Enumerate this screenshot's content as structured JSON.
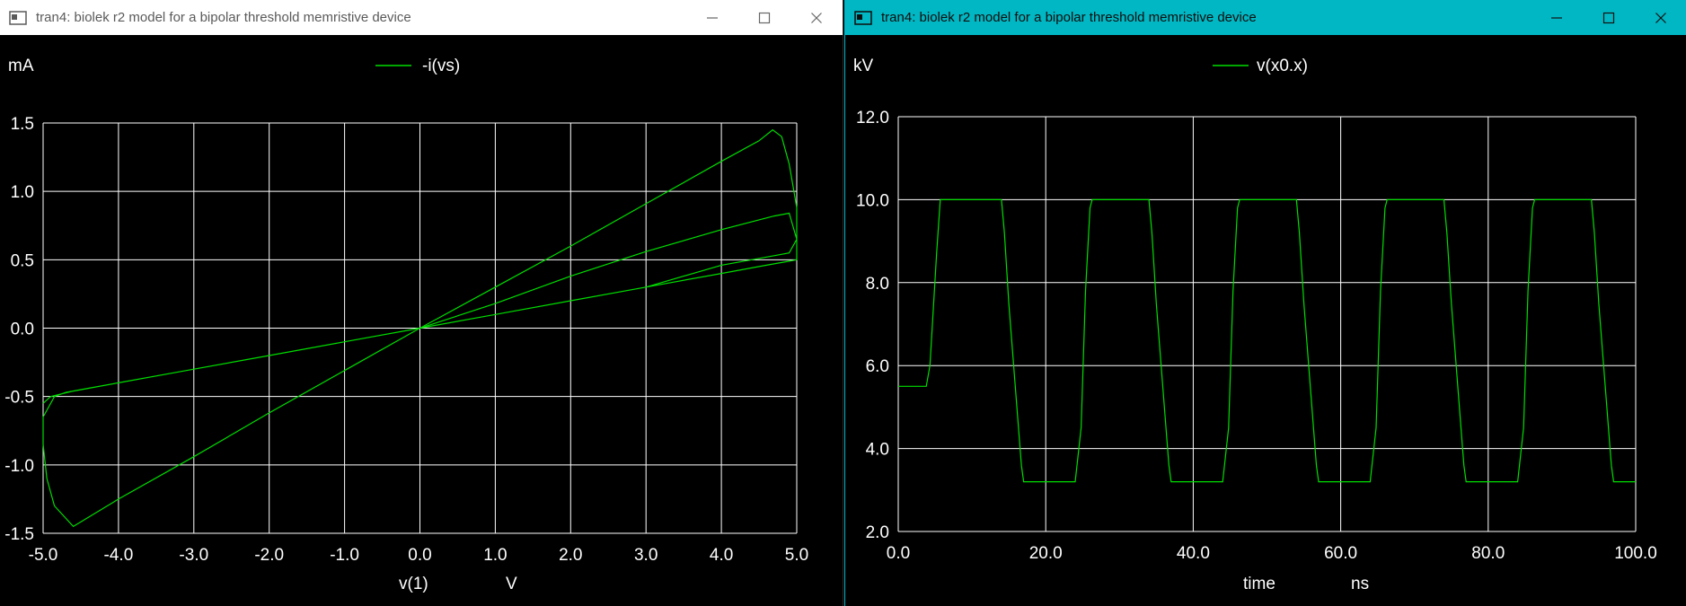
{
  "windows": {
    "left": {
      "title": "tran4: biolek r2 model for a bipolar threshold memristive device",
      "chart": {
        "type": "line",
        "unit_y": "mA",
        "unit_x": "V",
        "xlabel": "v(1)",
        "legend": "-i(vs)",
        "x_ticks": [
          "-5.0",
          "-4.0",
          "-3.0",
          "-2.0",
          "-1.0",
          "0.0",
          "1.0",
          "2.0",
          "3.0",
          "4.0",
          "5.0"
        ],
        "y_ticks": [
          "1.5",
          "1.0",
          "0.5",
          "0.0",
          "-0.5",
          "-1.0",
          "-1.5"
        ]
      }
    },
    "right": {
      "title": "tran4: biolek r2 model for a bipolar threshold memristive device",
      "chart": {
        "type": "line",
        "unit_y": "kV",
        "unit_x": "ns",
        "xlabel": "time",
        "legend": "v(x0.x)",
        "x_ticks": [
          "0.0",
          "20.0",
          "40.0",
          "60.0",
          "80.0",
          "100.0"
        ],
        "y_ticks": [
          "12.0",
          "10.0",
          "8.0",
          "6.0",
          "4.0",
          "2.0"
        ]
      }
    }
  },
  "colors": {
    "trace": "#00dd00",
    "grid": "#ffffff",
    "background": "#000000",
    "title_active": "#00b7c3"
  },
  "chart_data": [
    {
      "type": "line",
      "xlim": [
        -5,
        5
      ],
      "ylim": [
        -1.5,
        1.5
      ],
      "series": [
        {
          "name": "-i(vs)",
          "x": [
            0,
            1,
            2,
            3,
            4,
            4.5,
            4.68,
            4.8,
            4.9,
            5.0,
            5.0,
            4.9,
            4.8,
            4.7,
            4.5,
            4.0,
            3.0,
            2.0,
            1.0,
            0,
            -1.0,
            -2.0,
            -3.0,
            -4.0,
            -4.5,
            -4.7,
            -4.85,
            -5.0,
            -5.0,
            -4.95,
            -4.85,
            -4.6,
            -4.0,
            -3.0,
            -2.0,
            -1.0,
            0,
            1.0,
            2.0,
            3.0,
            4.0,
            4.7,
            4.9,
            5.0,
            4.9,
            4.7,
            4.0,
            3.0,
            2.0,
            1.0,
            0,
            -1.0,
            -2.0,
            -3.0,
            -4.0,
            -4.6,
            -4.9,
            -5.0
          ],
          "y": [
            0,
            0.3,
            0.6,
            0.91,
            1.22,
            1.37,
            1.45,
            1.4,
            1.2,
            0.88,
            0.5,
            0.49,
            0.48,
            0.47,
            0.45,
            0.4,
            0.3,
            0.2,
            0.1,
            0,
            -0.1,
            -0.2,
            -0.3,
            -0.4,
            -0.45,
            -0.47,
            -0.5,
            -0.65,
            -0.85,
            -1.1,
            -1.3,
            -1.45,
            -1.25,
            -0.94,
            -0.62,
            -0.31,
            0,
            0.18,
            0.38,
            0.56,
            0.72,
            0.82,
            0.84,
            0.65,
            0.55,
            0.53,
            0.46,
            0.3,
            0.2,
            0.1,
            0,
            -0.1,
            -0.2,
            -0.3,
            -0.4,
            -0.46,
            -0.5,
            -0.55
          ]
        }
      ]
    },
    {
      "type": "line",
      "xlim": [
        0,
        100
      ],
      "ylim": [
        2,
        12
      ],
      "series": [
        {
          "name": "v(x0.x)",
          "x": [
            0,
            3.8,
            4.3,
            5.2,
            5.7,
            14,
            14.4,
            15,
            16.7,
            17,
            24,
            24.8,
            25.4,
            26,
            26.3,
            34,
            34.4,
            35,
            36.7,
            37,
            44,
            44.8,
            45.4,
            46,
            46.3,
            54,
            54.4,
            55,
            56.7,
            57,
            64,
            64.8,
            65.4,
            66,
            66.3,
            74,
            74.4,
            75,
            76.7,
            77,
            84,
            84.8,
            85.4,
            86,
            86.3,
            94,
            94.4,
            95,
            96.7,
            97,
            100
          ],
          "y": [
            5.5,
            5.5,
            6.0,
            8.7,
            10,
            10,
            9.2,
            7.5,
            3.6,
            3.2,
            3.2,
            4.5,
            7.8,
            9.8,
            10,
            10,
            9.2,
            7.5,
            3.6,
            3.2,
            3.2,
            4.5,
            7.8,
            9.8,
            10,
            10,
            9.2,
            7.5,
            3.6,
            3.2,
            3.2,
            4.5,
            7.8,
            9.8,
            10,
            10,
            9.2,
            7.5,
            3.6,
            3.2,
            3.2,
            4.5,
            7.8,
            9.8,
            10,
            10,
            9.2,
            7.5,
            3.6,
            3.2,
            3.2
          ]
        }
      ]
    }
  ]
}
